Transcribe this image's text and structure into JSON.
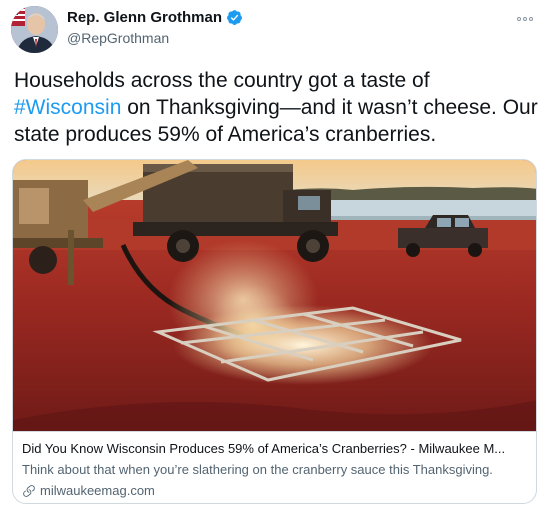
{
  "tweet": {
    "author_name": "Rep. Glenn Grothman",
    "author_handle": "@RepGrothman",
    "text_before": "Households across the country got a taste of ",
    "hashtag": "#Wisconsin",
    "text_after": " on Thanksgiving—and it wasn’t cheese. Our state produces 59% of America’s cranberries."
  },
  "card": {
    "title": "Did You Know Wisconsin Produces 59% of America’s Cranberries? - Milwaukee M...",
    "description": "Think about that when you’re slathering on the cranberry sauce this Thanksgiving.",
    "domain": "milwaukeemag.com"
  },
  "icons": {
    "verified": "verified-badge-icon",
    "more": "more-options-icon",
    "link": "link-icon"
  },
  "colors": {
    "accent": "#1d9bf0",
    "text": "#0f1419",
    "secondary": "#536471",
    "border": "#cfd9de"
  }
}
